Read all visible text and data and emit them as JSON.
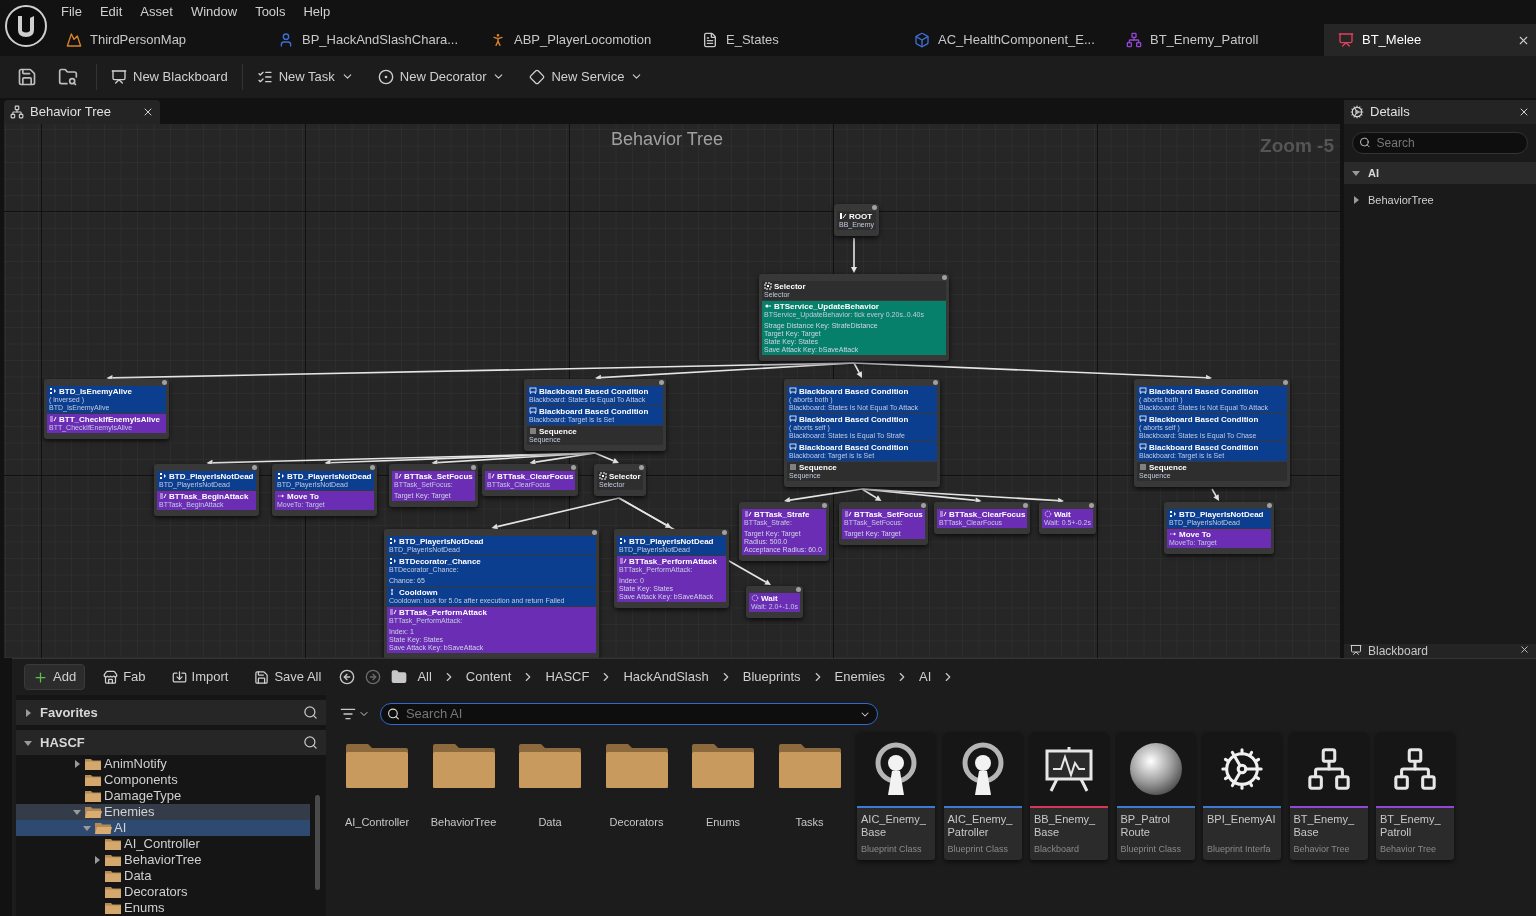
{
  "menu": [
    "File",
    "Edit",
    "Asset",
    "Window",
    "Tools",
    "Help"
  ],
  "document_tabs": [
    {
      "label": "ThirdPersonMap",
      "selected": false
    },
    {
      "label": "BP_HackAndSlashChara...",
      "selected": false
    },
    {
      "label": "ABP_PlayerLocomotion",
      "selected": false
    },
    {
      "label": "E_States",
      "selected": false
    },
    {
      "label": "AC_HealthComponent_E...",
      "selected": false
    },
    {
      "label": "BT_Enemy_Patroll",
      "selected": false
    },
    {
      "label": "BT_Melee",
      "selected": true
    }
  ],
  "toolbar": [
    {
      "label": "New Blackboard",
      "dropdown": false
    },
    {
      "label": "New Task",
      "dropdown": true
    },
    {
      "label": "New Decorator",
      "dropdown": true
    },
    {
      "label": "New Service",
      "dropdown": true
    }
  ],
  "editor_tab": {
    "label": "Behavior Tree"
  },
  "graph": {
    "title": "Behavior Tree",
    "zoom": "Zoom -5",
    "nodes": [
      {
        "sections": [
          {
            "kind": "root",
            "title": "ROOT",
            "summary": [
              "BB_Enemy"
            ]
          }
        ]
      },
      {
        "sections": [
          {
            "kind": "selector",
            "title": "Selector",
            "summary": [
              "Selector"
            ]
          },
          {
            "kind": "service",
            "title": "BTService_UpdateBehavior",
            "summary": [
              "BTService_UpdateBehavior: tick every 0.20s..0.40s"
            ],
            "properties": [
              "Strage Distance Key: StrafeDistance",
              "Target Key: Target",
              "State Key: States",
              "Save Attack Key: bSaveAttack"
            ]
          }
        ]
      },
      {
        "sections": [
          {
            "kind": "decorator",
            "title": "BTD_IsEnemyAlive",
            "summary": [
              "( inversed )",
              "BTD_IsEnemyAlive"
            ]
          },
          {
            "kind": "task",
            "title": "BTT_CheckIfEnemyIsAlive",
            "summary": [
              "BTT_CheckIfEnemyIsAlive"
            ]
          }
        ]
      },
      {
        "sections": [
          {
            "kind": "condition",
            "title": "Blackboard Based Condition",
            "summary": [
              "Blackboard: States Is Equal To Attack"
            ]
          },
          {
            "kind": "condition",
            "title": "Blackboard Based Condition",
            "summary": [
              "Blackboard: Target is Is Set"
            ]
          },
          {
            "kind": "sequence",
            "title": "Sequence",
            "summary": [
              "Sequence"
            ]
          }
        ]
      },
      {
        "sections": [
          {
            "kind": "condition",
            "title": "Blackboard Based Condition",
            "summary": [
              "( aborts both )",
              "Blackboard: States Is Not Equal To Attack"
            ]
          },
          {
            "kind": "condition",
            "title": "Blackboard Based Condition",
            "summary": [
              "( aborts self )",
              "Blackboard: States Is Equal To Strafe"
            ]
          },
          {
            "kind": "condition",
            "title": "Blackboard Based Condition",
            "summary": [
              "Blackboard: Target is Is Set"
            ]
          },
          {
            "kind": "sequence",
            "title": "Sequence",
            "summary": [
              "Sequence"
            ]
          }
        ]
      },
      {
        "sections": [
          {
            "kind": "condition",
            "title": "Blackboard Based Condition",
            "summary": [
              "( aborts both )",
              "Blackboard: States Is Not Equal To Attack"
            ]
          },
          {
            "kind": "condition",
            "title": "Blackboard Based Condition",
            "summary": [
              "( aborts self )",
              "Blackboard: States Is Equal To Chase"
            ]
          },
          {
            "kind": "condition",
            "title": "Blackboard Based Condition",
            "summary": [
              "Blackboard: Target is Is Set"
            ]
          },
          {
            "kind": "sequence",
            "title": "Sequence",
            "summary": [
              "Sequence"
            ]
          }
        ]
      },
      {
        "sections": [
          {
            "kind": "decorator",
            "title": "BTD_PlayerIsNotDead",
            "summary": [
              "BTD_PlayerIsNotDead"
            ]
          },
          {
            "kind": "task",
            "title": "BTTask_BeginAttack",
            "summary": [
              "BTTask_BeginAttack"
            ]
          }
        ]
      },
      {
        "sections": [
          {
            "kind": "decorator",
            "title": "BTD_PlayerIsNotDead",
            "summary": [
              "BTD_PlayerIsNotDead"
            ]
          },
          {
            "kind": "move",
            "title": "Move To",
            "summary": [
              "MoveTo: Target"
            ]
          }
        ]
      },
      {
        "sections": [
          {
            "kind": "task",
            "title": "BTTask_SetFocus",
            "summary": [
              "BTTask_SetFocus:"
            ],
            "properties": [
              "Target Key: Target"
            ]
          }
        ]
      },
      {
        "sections": [
          {
            "kind": "task",
            "title": "BTTask_ClearFocus",
            "summary": [
              "BTTask_ClearFocus"
            ]
          }
        ]
      },
      {
        "sections": [
          {
            "kind": "selector",
            "title": "Selector",
            "summary": [
              "Selector"
            ]
          }
        ]
      },
      {
        "sections": [
          {
            "kind": "task",
            "title": "BTTask_Strafe",
            "summary": [
              "BTTask_Strafe:"
            ],
            "properties": [
              "Target Key: Target",
              "Radius: 500.0",
              "Acceptance Radius: 60.0"
            ]
          }
        ]
      },
      {
        "sections": [
          {
            "kind": "task",
            "title": "BTTask_SetFocus",
            "summary": [
              "BTTask_SetFocus:"
            ],
            "properties": [
              "Target Key: Target"
            ]
          }
        ]
      },
      {
        "sections": [
          {
            "kind": "task",
            "title": "BTTask_ClearFocus",
            "summary": [
              "BTTask_ClearFocus"
            ]
          }
        ]
      },
      {
        "sections": [
          {
            "kind": "wait",
            "title": "Wait",
            "summary": [
              "Wait: 0.5+-0.2s"
            ]
          }
        ]
      },
      {
        "sections": [
          {
            "kind": "decorator",
            "title": "BTD_PlayerIsNotDead",
            "summary": [
              "BTD_PlayerIsNotDead"
            ]
          },
          {
            "kind": "move",
            "title": "Move To",
            "summary": [
              "MoveTo: Target"
            ]
          }
        ]
      },
      {
        "sections": [
          {
            "kind": "decorator",
            "title": "BTD_PlayerIsNotDead",
            "summary": [
              "BTD_PlayerIsNotDead"
            ]
          },
          {
            "kind": "decorator",
            "title": "BTDecorator_Chance",
            "summary": [
              "BTDecorator_Chance:"
            ],
            "properties": [
              "Chance: 65"
            ]
          },
          {
            "kind": "cooldown",
            "title": "Cooldown",
            "summary": [
              "Cooldown: lock for 5.0s after execution and return Failed"
            ]
          },
          {
            "kind": "task",
            "title": "BTTask_PerformAttack",
            "summary": [
              "BTTask_PerformAttack:"
            ],
            "properties": [
              "Index: 1",
              "State Key: States",
              "Save Attack Key: bSaveAttack"
            ]
          }
        ]
      },
      {
        "sections": [
          {
            "kind": "decorator",
            "title": "BTD_PlayerIsNotDead",
            "summary": [
              "BTD_PlayerIsNotDead"
            ]
          },
          {
            "kind": "task",
            "title": "BTTask_PerformAttack",
            "summary": [
              "BTTask_PerformAttack:"
            ],
            "properties": [
              "Index: 0",
              "State Key: States",
              "Save Attack Key: bSaveAttack"
            ]
          }
        ]
      },
      {
        "sections": [
          {
            "kind": "wait",
            "title": "Wait",
            "summary": [
              "Wait: 2.0+-1.0s"
            ]
          }
        ]
      }
    ]
  },
  "details": {
    "title": "Details",
    "search": {
      "placeholder": "Search"
    },
    "categories": [
      {
        "label": "AI",
        "expanded": true,
        "children": [
          {
            "label": "BehaviorTree",
            "expanded": false
          }
        ]
      }
    ],
    "blackboard_tab": "Blackboard"
  },
  "content_browser": {
    "actions": [
      {
        "kind": "add",
        "label": "Add"
      },
      {
        "kind": "fab",
        "label": "Fab"
      },
      {
        "kind": "import",
        "label": "Import"
      },
      {
        "kind": "save",
        "label": "Save All"
      }
    ],
    "breadcrumbs": [
      "All",
      "Content",
      "HASCF",
      "HackAndSlash",
      "Blueprints",
      "Enemies",
      "AI"
    ],
    "sections": [
      {
        "label": "Favorites",
        "expanded": false
      },
      {
        "label": "HASCF",
        "expanded": true
      }
    ],
    "tree": [
      {
        "label": "AnimNotify",
        "has_children": true,
        "expanded": false,
        "selected": false,
        "highlighted": false
      },
      {
        "label": "Components",
        "has_children": false,
        "expanded": false,
        "selected": false,
        "highlighted": false
      },
      {
        "label": "DamageType",
        "has_children": false,
        "expanded": false,
        "selected": false,
        "highlighted": false
      },
      {
        "label": "Enemies",
        "has_children": true,
        "expanded": true,
        "selected": false,
        "highlighted": true,
        "children": [
          {
            "label": "AI",
            "has_children": true,
            "expanded": true,
            "selected": true,
            "highlighted": false,
            "children": [
              {
                "label": "AI_Controller",
                "has_children": false,
                "expanded": false,
                "selected": false,
                "highlighted": false
              },
              {
                "label": "BehaviorTree",
                "has_children": true,
                "expanded": false,
                "selected": false,
                "highlighted": false
              },
              {
                "label": "Data",
                "has_children": false,
                "expanded": false,
                "selected": false,
                "highlighted": false
              },
              {
                "label": "Decorators",
                "has_children": false,
                "expanded": false,
                "selected": false,
                "highlighted": false
              },
              {
                "label": "Enums",
                "has_children": false,
                "expanded": false,
                "selected": false,
                "highlighted": false
              }
            ]
          }
        ]
      }
    ],
    "search": {
      "placeholder": "Search AI"
    },
    "assets": [
      {
        "kind": "folder",
        "name": "AI_Controller"
      },
      {
        "kind": "folder",
        "name": "BehaviorTree"
      },
      {
        "kind": "folder",
        "name": "Data"
      },
      {
        "kind": "folder",
        "name": "Decorators"
      },
      {
        "kind": "folder",
        "name": "Enums"
      },
      {
        "kind": "folder",
        "name": "Tasks"
      },
      {
        "kind": "ai_controller",
        "name": "AIC_Enemy_Base",
        "type": "Blueprint Class",
        "color": "#3d7ad6"
      },
      {
        "kind": "ai_controller",
        "name": "AIC_Enemy_Patroller",
        "type": "Blueprint Class",
        "color": "#3d7ad6"
      },
      {
        "kind": "blackboard",
        "name": "BB_Enemy_Base",
        "type": "Blackboard",
        "color": "#d6365a"
      },
      {
        "kind": "blueprint",
        "name": "BP_Patrol Route",
        "type": "Blueprint Class",
        "color": "#3d7ad6"
      },
      {
        "kind": "interface",
        "name": "BPI_EnemyAI",
        "type": "Blueprint Interfa",
        "color": "#3d7ad6"
      },
      {
        "kind": "behavior_tree",
        "name": "BT_Enemy_Base",
        "type": "Behavior Tree",
        "color": "#9346d6"
      },
      {
        "kind": "behavior_tree",
        "name": "BT_Enemy_Patroll",
        "type": "Behavior Tree",
        "color": "#9346d6"
      }
    ]
  }
}
